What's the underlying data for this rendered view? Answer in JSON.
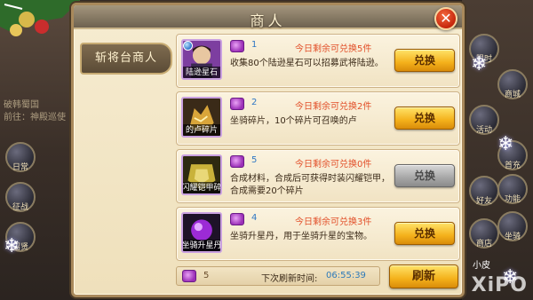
{
  "dialog": {
    "title": "商人",
    "close_glyph": "✕",
    "merchant_tab": "斩将台商人"
  },
  "items": [
    {
      "icon_name": "lu-xun-star-stone-icon",
      "icon_label": "陆逊星石",
      "cost": "1",
      "remaining": "今日剩余可兑换5件",
      "description": "收集80个陆逊星石可以招募武将陆逊。",
      "button": "兑换",
      "enabled": true
    },
    {
      "icon_name": "dilu-fragment-icon",
      "icon_label": "的卢碎片",
      "cost": "2",
      "remaining": "今日剩余可兑换2件",
      "description": "坐骑碎片，10个碎片可召唤的卢",
      "button": "兑换",
      "enabled": true
    },
    {
      "icon_name": "shining-armor-fragment-icon",
      "icon_label": "闪耀铠甲碎",
      "cost": "5",
      "remaining": "今日剩余可兑换0件",
      "description": "合成材料，合成后可获得时装闪耀铠甲，合成需要20个碎片",
      "button": "兑换",
      "enabled": false
    },
    {
      "icon_name": "mount-upgrade-pill-icon",
      "icon_label": "坐骑升星丹",
      "cost": "4",
      "remaining": "今日剩余可兑换3件",
      "description": "坐骑升星丹，用于坐骑升星的宝物。",
      "button": "兑换",
      "enabled": true
    }
  ],
  "footer": {
    "currency": "5",
    "refresh_label": "下次刷新时间:",
    "refresh_time": "06:55:39",
    "refresh_button": "刷新"
  },
  "background": {
    "left_text_1": "破韩蜀国",
    "left_text_2": "前往：神殿巡使",
    "side_buttons": [
      "日常",
      "征战",
      "招贤"
    ],
    "right_buttons": [
      "限时",
      "商城",
      "活动",
      "首充",
      "好友",
      "坐骑",
      "商店",
      "功能"
    ],
    "right_bottom_label": "小皮",
    "watermark": "XiPO"
  },
  "colors": {
    "accent_orange": "#e2502a",
    "cost_blue": "#2f77c4",
    "gold_button": "#f4b11b",
    "disabled_button": "#a6a6a6"
  }
}
